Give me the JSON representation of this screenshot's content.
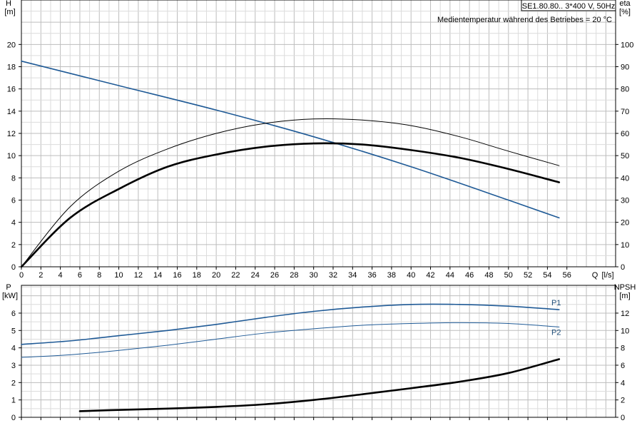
{
  "chart_data": [
    {
      "type": "line",
      "x_axis": {
        "label": "Q",
        "unit": "[l/s]",
        "range": [
          0,
          61
        ],
        "ticks": [
          0,
          2,
          4,
          6,
          8,
          10,
          12,
          14,
          16,
          18,
          20,
          22,
          24,
          26,
          28,
          30,
          32,
          34,
          36,
          38,
          40,
          42,
          44,
          46,
          48,
          50,
          52,
          54,
          56
        ]
      },
      "y_left": {
        "label": "H",
        "unit": "[m]",
        "range": [
          0,
          24
        ],
        "ticks": [
          0,
          2,
          4,
          6,
          8,
          10,
          12,
          14,
          16,
          18,
          20
        ]
      },
      "y_right": {
        "label": "eta",
        "unit": "[%]",
        "range": [
          0,
          120
        ],
        "ticks": [
          0,
          10,
          20,
          30,
          40,
          50,
          60,
          70,
          80,
          90,
          100
        ]
      },
      "grid": true,
      "info_box": "SE1.80.80.. 3*400 V, 50Hz",
      "annotation": "Medientemperatur während des Betriebes = 20 °C",
      "series": [
        {
          "axis": "left",
          "color": "#1f5a96",
          "stroke": "medium",
          "x": [
            0,
            10,
            20,
            30,
            40,
            50,
            55.2
          ],
          "y": [
            18.5,
            16.3,
            14.1,
            11.7,
            9.0,
            6.0,
            4.4
          ]
        },
        {
          "axis": "right",
          "color": "#000000",
          "stroke": "thin",
          "x": [
            0,
            5,
            10,
            15,
            20,
            25,
            30,
            35,
            40,
            45,
            50,
            55.2
          ],
          "y": [
            0,
            27,
            43,
            53,
            60,
            64.5,
            66.5,
            66,
            63.5,
            58.5,
            52,
            45.5
          ]
        },
        {
          "axis": "right",
          "color": "#000000",
          "stroke": "thick",
          "x": [
            0,
            5,
            10,
            15,
            20,
            25,
            30,
            35,
            40,
            45,
            50,
            55.2
          ],
          "y": [
            0,
            22,
            35,
            45,
            50.5,
            54,
            55.5,
            55,
            52.5,
            49,
            44,
            38
          ]
        }
      ]
    },
    {
      "type": "line",
      "x_axis": {
        "range": [
          0,
          61
        ],
        "ticks": [
          0,
          2,
          4,
          6,
          8,
          10,
          12,
          14,
          16,
          18,
          20,
          22,
          24,
          26,
          28,
          30,
          32,
          34,
          36,
          38,
          40,
          42,
          44,
          46,
          48,
          50,
          52,
          54,
          56
        ]
      },
      "y_left": {
        "label": "P",
        "unit": "[kW]",
        "range": [
          0,
          7.6
        ],
        "ticks": [
          0,
          1,
          2,
          3,
          4,
          5,
          6
        ]
      },
      "y_right": {
        "label": "NPSH",
        "unit": "[m]",
        "range": [
          0,
          15.2
        ],
        "ticks": [
          0,
          2,
          4,
          6,
          8,
          10,
          12
        ]
      },
      "grid": true,
      "series": [
        {
          "name": "P1",
          "axis": "left",
          "color": "#1f5a96",
          "stroke": "medium",
          "x": [
            0,
            5,
            10,
            15,
            20,
            25,
            30,
            35,
            40,
            45,
            50,
            55.2
          ],
          "y": [
            4.2,
            4.4,
            4.7,
            5.0,
            5.35,
            5.75,
            6.1,
            6.35,
            6.5,
            6.5,
            6.4,
            6.2
          ]
        },
        {
          "name": "P2",
          "axis": "left",
          "color": "#1f5a96",
          "stroke": "thin",
          "x": [
            0,
            5,
            10,
            15,
            20,
            25,
            30,
            35,
            40,
            45,
            50,
            55.2
          ],
          "y": [
            3.45,
            3.6,
            3.85,
            4.15,
            4.5,
            4.85,
            5.1,
            5.3,
            5.4,
            5.45,
            5.4,
            5.2
          ]
        },
        {
          "axis": "right",
          "color": "#000000",
          "stroke": "thick",
          "x": [
            6,
            10,
            15,
            20,
            25,
            30,
            35,
            40,
            45,
            50,
            55.2
          ],
          "y": [
            0.7,
            0.85,
            1.0,
            1.2,
            1.5,
            2.0,
            2.65,
            3.35,
            4.1,
            5.1,
            6.7
          ]
        }
      ]
    }
  ]
}
